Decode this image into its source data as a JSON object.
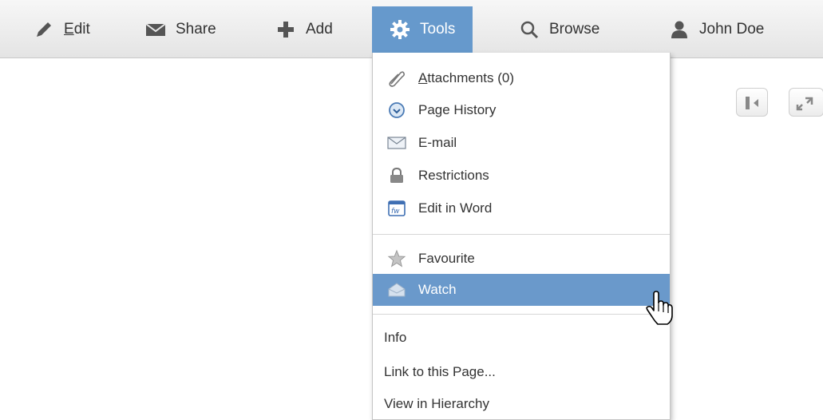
{
  "toolbar": {
    "items": [
      {
        "label": "Edit",
        "icon": "pencil-icon"
      },
      {
        "label": "Share",
        "icon": "envelope-icon"
      },
      {
        "label": "Add",
        "icon": "plus-icon"
      },
      {
        "label": "Tools",
        "icon": "gear-icon",
        "active": true
      },
      {
        "label": "Browse",
        "icon": "search-icon"
      },
      {
        "label": "John Doe",
        "icon": "user-icon"
      }
    ],
    "active_color": "#6699cc"
  },
  "tools_menu": {
    "group1": [
      {
        "label": "Attachments (0)",
        "icon": "paperclip-icon"
      },
      {
        "label": "Page History",
        "icon": "clock-icon"
      },
      {
        "label": "E-mail",
        "icon": "mail-icon"
      },
      {
        "label": "Restrictions",
        "icon": "lock-icon"
      },
      {
        "label": "Edit in Word",
        "icon": "word-icon"
      }
    ],
    "group2": [
      {
        "label": "Favourite",
        "icon": "star-icon"
      },
      {
        "label": "Watch",
        "icon": "watch-envelope-icon",
        "highlighted": true
      }
    ],
    "group3": [
      {
        "label": "Info"
      },
      {
        "label": "Link to this Page..."
      },
      {
        "label": "View in Hierarchy"
      }
    ],
    "highlight_color": "#6a99cb"
  }
}
